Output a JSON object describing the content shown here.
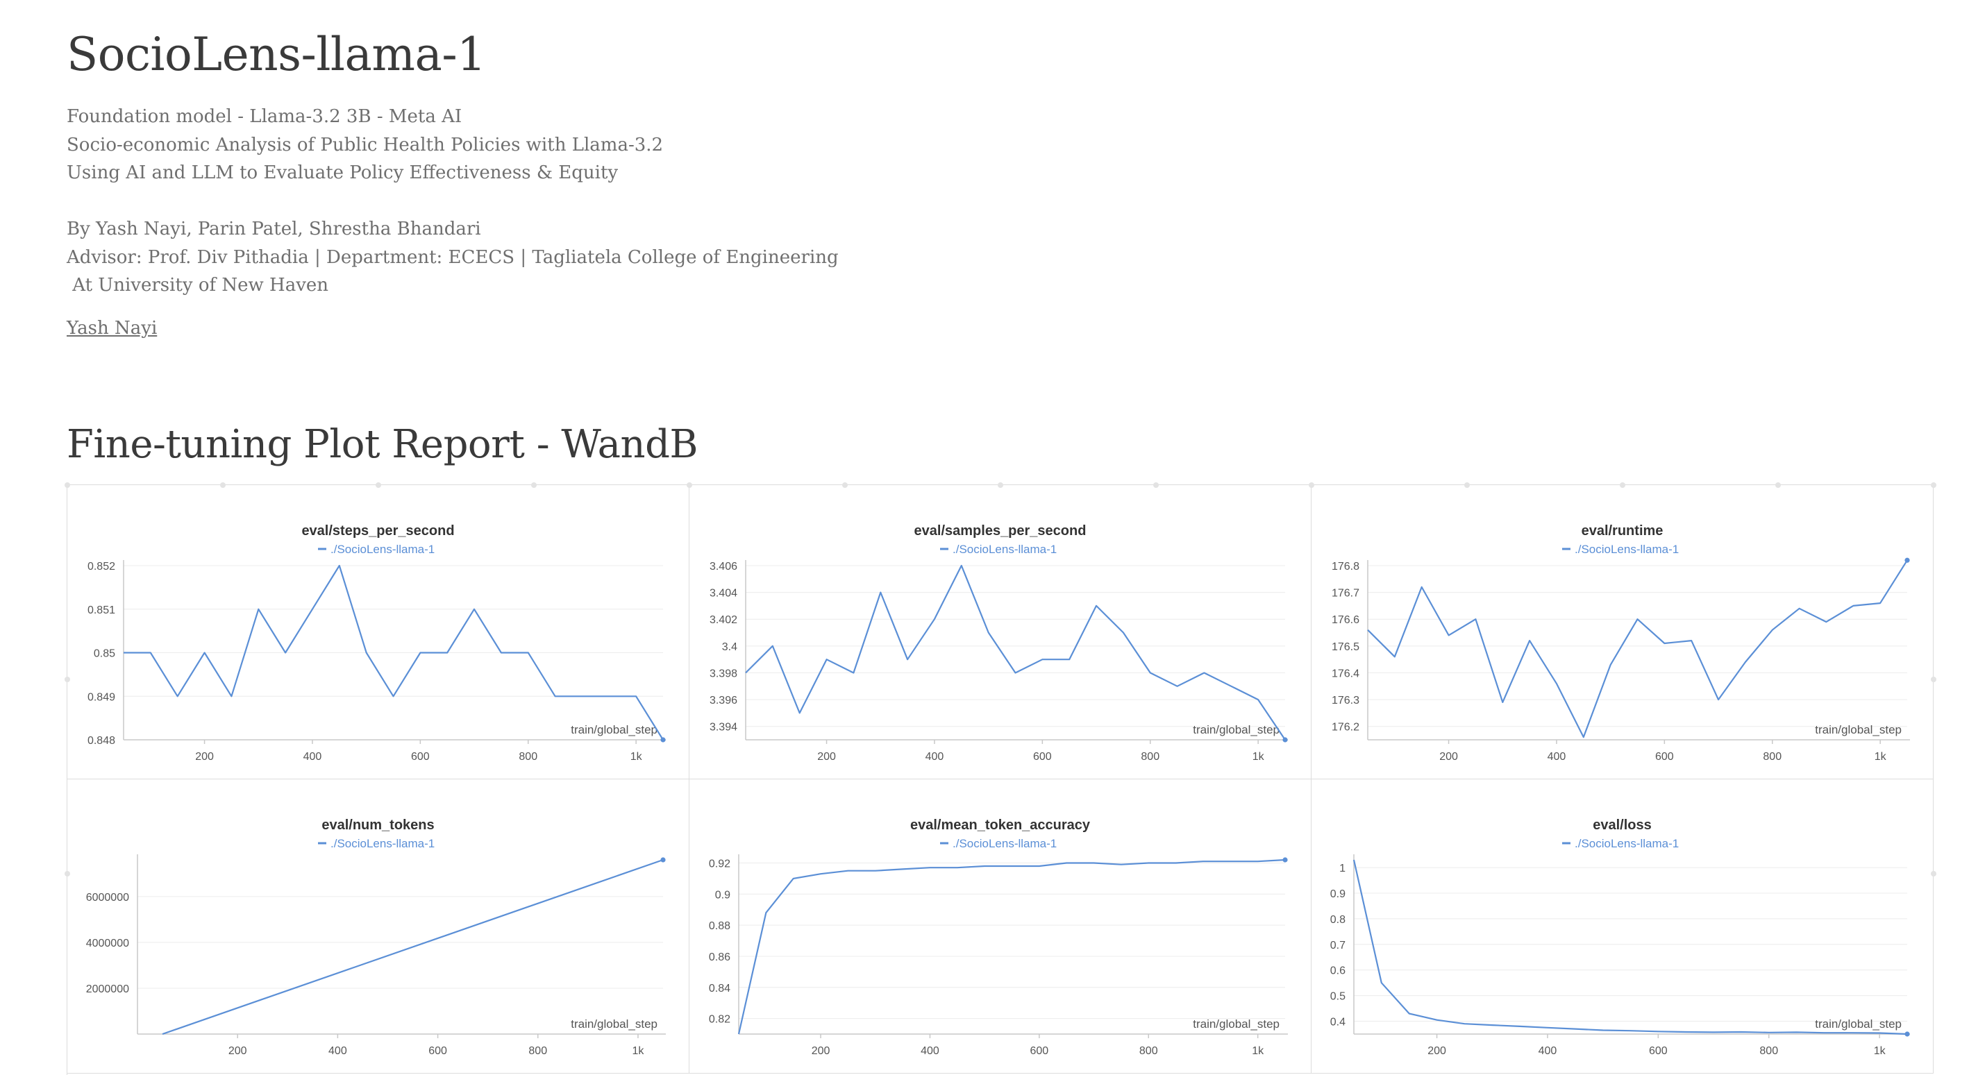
{
  "header": {
    "title": "SocioLens-llama-1",
    "meta_lines": [
      "Foundation model - Llama-3.2 3B - Meta AI",
      "Socio-economic Analysis of Public Health Policies with Llama-3.2",
      "Using AI and LLM to Evaluate Policy Effectiveness & Equity",
      "",
      "By Yash Nayi, Parin Patel, Shrestha Bhandari",
      "Advisor: Prof. Div Pithadia | Department: ECECS | Tagliatela College of Engineering",
      " At University of New Haven"
    ],
    "author_link": "Yash Nayi"
  },
  "section": {
    "title": "Fine-tuning Plot Report - WandB"
  },
  "colors": {
    "series": "#5b8fd6",
    "text": "#3a3a3a",
    "muted": "#6f6f6f"
  },
  "chart_data": [
    {
      "type": "line",
      "title": "eval/steps_per_second",
      "legend": "./SocioLens-llama-1",
      "xlabel": "train/global_step",
      "xlim": [
        50,
        1050
      ],
      "ylim": [
        0.848,
        0.852
      ],
      "xticks": [
        200,
        400,
        600,
        800,
        1000
      ],
      "xtick_labels": [
        "200",
        "400",
        "600",
        "800",
        "1k"
      ],
      "yticks": [
        0.848,
        0.849,
        0.85,
        0.851,
        0.852
      ],
      "ytick_labels": [
        "0.848",
        "0.849",
        "0.85",
        "0.851",
        "0.852"
      ],
      "series": [
        {
          "name": "./SocioLens-llama-1",
          "x": [
            50,
            100,
            150,
            200,
            250,
            300,
            350,
            400,
            450,
            500,
            550,
            600,
            650,
            700,
            750,
            800,
            850,
            900,
            950,
            1000,
            1050
          ],
          "y": [
            0.85,
            0.85,
            0.849,
            0.85,
            0.849,
            0.851,
            0.85,
            0.851,
            0.852,
            0.85,
            0.849,
            0.85,
            0.85,
            0.851,
            0.85,
            0.85,
            0.849,
            0.849,
            0.849,
            0.849,
            0.848
          ]
        }
      ],
      "end_marker": true
    },
    {
      "type": "line",
      "title": "eval/samples_per_second",
      "legend": "./SocioLens-llama-1",
      "xlabel": "train/global_step",
      "xlim": [
        50,
        1050
      ],
      "ylim": [
        3.393,
        3.406
      ],
      "xticks": [
        200,
        400,
        600,
        800,
        1000
      ],
      "xtick_labels": [
        "200",
        "400",
        "600",
        "800",
        "1k"
      ],
      "yticks": [
        3.394,
        3.396,
        3.398,
        3.4,
        3.402,
        3.404,
        3.406
      ],
      "ytick_labels": [
        "3.394",
        "3.396",
        "3.398",
        "3.4",
        "3.402",
        "3.404",
        "3.406"
      ],
      "series": [
        {
          "name": "./SocioLens-llama-1",
          "x": [
            50,
            100,
            150,
            200,
            250,
            300,
            350,
            400,
            450,
            500,
            550,
            600,
            650,
            700,
            750,
            800,
            850,
            900,
            950,
            1000,
            1050
          ],
          "y": [
            3.398,
            3.4,
            3.395,
            3.399,
            3.398,
            3.404,
            3.399,
            3.402,
            3.406,
            3.401,
            3.398,
            3.399,
            3.399,
            3.403,
            3.401,
            3.398,
            3.397,
            3.398,
            3.397,
            3.396,
            3.393
          ]
        }
      ],
      "end_marker": true
    },
    {
      "type": "line",
      "title": "eval/runtime",
      "legend": "./SocioLens-llama-1",
      "xlabel": "train/global_step",
      "xlim": [
        50,
        1050
      ],
      "ylim": [
        176.15,
        176.8
      ],
      "xticks": [
        200,
        400,
        600,
        800,
        1000
      ],
      "xtick_labels": [
        "200",
        "400",
        "600",
        "800",
        "1k"
      ],
      "yticks": [
        176.2,
        176.3,
        176.4,
        176.5,
        176.6,
        176.7,
        176.8
      ],
      "ytick_labels": [
        "176.2",
        "176.3",
        "176.4",
        "176.5",
        "176.6",
        "176.7",
        "176.8"
      ],
      "series": [
        {
          "name": "./SocioLens-llama-1",
          "x": [
            50,
            100,
            150,
            200,
            250,
            300,
            350,
            400,
            450,
            500,
            550,
            600,
            650,
            700,
            750,
            800,
            850,
            900,
            950,
            1000,
            1050
          ],
          "y": [
            176.56,
            176.46,
            176.72,
            176.54,
            176.6,
            176.29,
            176.52,
            176.36,
            176.16,
            176.43,
            176.6,
            176.51,
            176.52,
            176.3,
            176.44,
            176.56,
            176.64,
            176.59,
            176.65,
            176.66,
            176.82
          ]
        }
      ],
      "end_marker": true
    },
    {
      "type": "line",
      "title": "eval/num_tokens",
      "legend": "./SocioLens-llama-1",
      "xlabel": "train/global_step",
      "xlim": [
        0,
        1050
      ],
      "ylim": [
        0,
        7600000
      ],
      "xticks": [
        200,
        400,
        600,
        800,
        1000
      ],
      "xtick_labels": [
        "200",
        "400",
        "600",
        "800",
        "1k"
      ],
      "yticks": [
        2000000,
        4000000,
        6000000
      ],
      "ytick_labels": [
        "2000000",
        "4000000",
        "6000000"
      ],
      "series": [
        {
          "name": "./SocioLens-llama-1",
          "x": [
            50,
            1050
          ],
          "y": [
            0,
            7600000
          ]
        }
      ],
      "end_marker": true
    },
    {
      "type": "line",
      "title": "eval/mean_token_accuracy",
      "legend": "./SocioLens-llama-1",
      "xlabel": "train/global_step",
      "xlim": [
        50,
        1050
      ],
      "ylim": [
        0.81,
        0.922
      ],
      "xticks": [
        200,
        400,
        600,
        800,
        1000
      ],
      "xtick_labels": [
        "200",
        "400",
        "600",
        "800",
        "1k"
      ],
      "yticks": [
        0.82,
        0.84,
        0.86,
        0.88,
        0.9,
        0.92
      ],
      "ytick_labels": [
        "0.82",
        "0.84",
        "0.86",
        "0.88",
        "0.9",
        "0.92"
      ],
      "series": [
        {
          "name": "./SocioLens-llama-1",
          "x": [
            50,
            100,
            150,
            200,
            250,
            300,
            350,
            400,
            450,
            500,
            550,
            600,
            650,
            700,
            750,
            800,
            850,
            900,
            950,
            1000,
            1050
          ],
          "y": [
            0.81,
            0.888,
            0.91,
            0.913,
            0.915,
            0.915,
            0.916,
            0.917,
            0.917,
            0.918,
            0.918,
            0.918,
            0.92,
            0.92,
            0.919,
            0.92,
            0.92,
            0.921,
            0.921,
            0.921,
            0.922
          ]
        }
      ],
      "end_marker": true
    },
    {
      "type": "line",
      "title": "eval/loss",
      "legend": "./SocioLens-llama-1",
      "xlabel": "train/global_step",
      "xlim": [
        50,
        1050
      ],
      "ylim": [
        0.35,
        1.03
      ],
      "xticks": [
        200,
        400,
        600,
        800,
        1000
      ],
      "xtick_labels": [
        "200",
        "400",
        "600",
        "800",
        "1k"
      ],
      "yticks": [
        0.4,
        0.5,
        0.6,
        0.7,
        0.8,
        0.9,
        1
      ],
      "ytick_labels": [
        "0.4",
        "0.5",
        "0.6",
        "0.7",
        "0.8",
        "0.9",
        "1"
      ],
      "series": [
        {
          "name": "./SocioLens-llama-1",
          "x": [
            50,
            100,
            150,
            200,
            250,
            300,
            350,
            400,
            450,
            500,
            550,
            600,
            650,
            700,
            750,
            800,
            850,
            900,
            950,
            1000,
            1050
          ],
          "y": [
            1.03,
            0.55,
            0.43,
            0.405,
            0.39,
            0.385,
            0.38,
            0.375,
            0.37,
            0.365,
            0.363,
            0.36,
            0.358,
            0.357,
            0.358,
            0.356,
            0.357,
            0.355,
            0.355,
            0.354,
            0.35
          ]
        }
      ],
      "end_marker": true
    }
  ]
}
